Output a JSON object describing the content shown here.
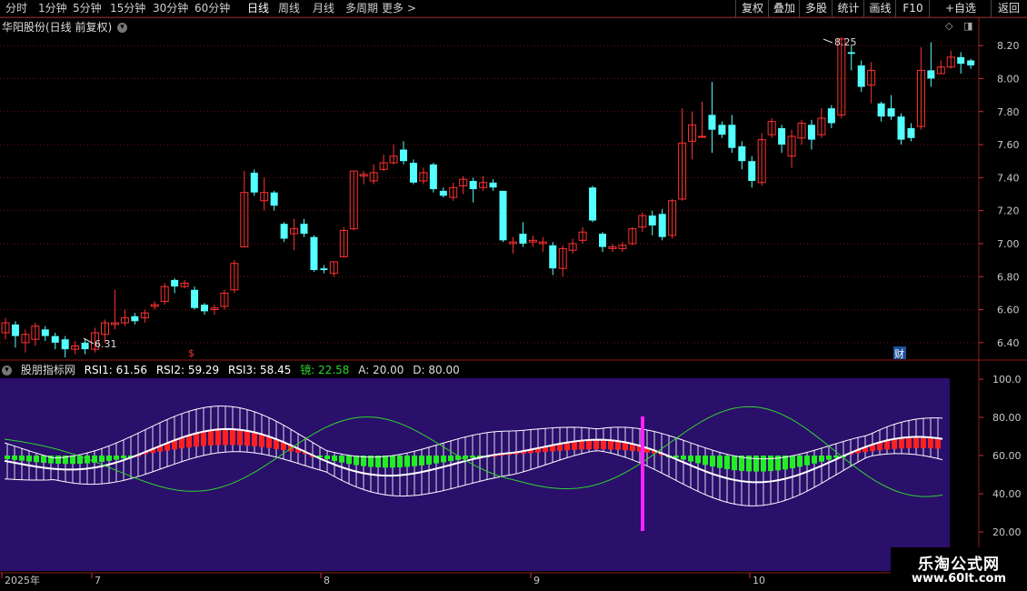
{
  "toolbar": {
    "periods": [
      "分时",
      "1分钟",
      "5分钟",
      "15分钟",
      "30分钟",
      "60分钟",
      "日线",
      "周线",
      "月线",
      "多周期",
      "更多 >"
    ],
    "active_period": "日线",
    "right_buttons": [
      "复权",
      "叠加",
      "多股",
      "统计",
      "画线",
      "F10",
      "+自选",
      "返回"
    ]
  },
  "main": {
    "title": "华阳股份(日线 前复权)",
    "price_axis": [
      "8.20",
      "8.00",
      "7.80",
      "7.60",
      "7.40",
      "7.20",
      "7.00",
      "6.80",
      "6.60",
      "6.40"
    ],
    "high_label": "8.25",
    "low_label": "6.31",
    "event_marker": "财",
    "small_marker": "$"
  },
  "indicator": {
    "name": "股朋指标网",
    "rsi1": "RSI1: 61.56",
    "rsi2": "RSI2: 59.29",
    "rsi3": "RSI3: 58.45",
    "jing": "镜: 22.58",
    "a": "A: 20.00",
    "d": "D: 80.00",
    "axis": [
      "100.0",
      "80.00",
      "60.00",
      "40.00",
      "20.00"
    ]
  },
  "date_axis": [
    "2025年",
    "7",
    "8",
    "9",
    "10"
  ],
  "watermark": {
    "title": "乐淘公式网",
    "url": "www.60lt.com"
  },
  "colors": {
    "up": "#ff3232",
    "down": "#54ffff",
    "panel_bg": "#2a0f6b",
    "mirror": "#2fd32f",
    "marker": "#ff22ff"
  }
}
